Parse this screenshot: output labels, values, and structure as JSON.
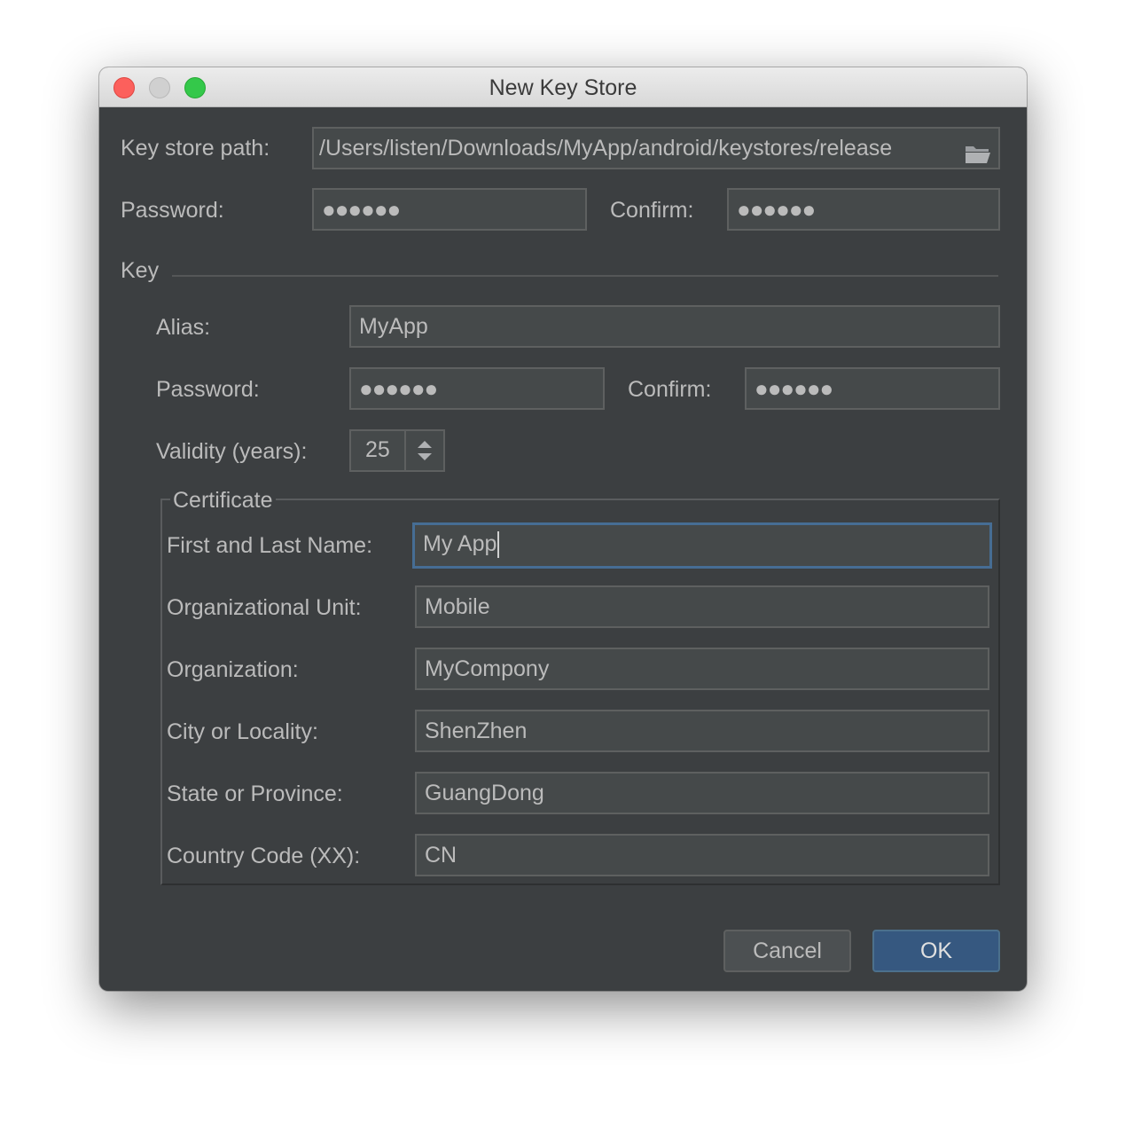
{
  "window": {
    "title": "New Key Store"
  },
  "keystore": {
    "path_label": "Key store path:",
    "path_value": "/Users/listen/Downloads/MyApp/android/keystores/release",
    "password_label": "Password:",
    "password_value": "●●●●●●",
    "confirm_label": "Confirm:",
    "confirm_value": "●●●●●●"
  },
  "key": {
    "section_label": "Key",
    "alias_label": "Alias:",
    "alias_value": "MyApp",
    "password_label": "Password:",
    "password_value": "●●●●●●",
    "confirm_label": "Confirm:",
    "confirm_value": "●●●●●●",
    "validity_label": "Validity (years):",
    "validity_value": "25"
  },
  "certificate": {
    "title": "Certificate",
    "first_last_label": "First and Last Name:",
    "first_last_value": "My App",
    "org_unit_label": "Organizational Unit:",
    "org_unit_value": "Mobile",
    "org_label": "Organization:",
    "org_value": "MyCompony",
    "city_label": "City or Locality:",
    "city_value": "ShenZhen",
    "state_label": "State or Province:",
    "state_value": "GuangDong",
    "country_label": "Country Code (XX):",
    "country_value": "CN"
  },
  "buttons": {
    "cancel": "Cancel",
    "ok": "OK"
  },
  "colors": {
    "background": "#3c3f41",
    "field": "#45494a",
    "focus_border": "#466d94",
    "ok_button": "#365880"
  }
}
